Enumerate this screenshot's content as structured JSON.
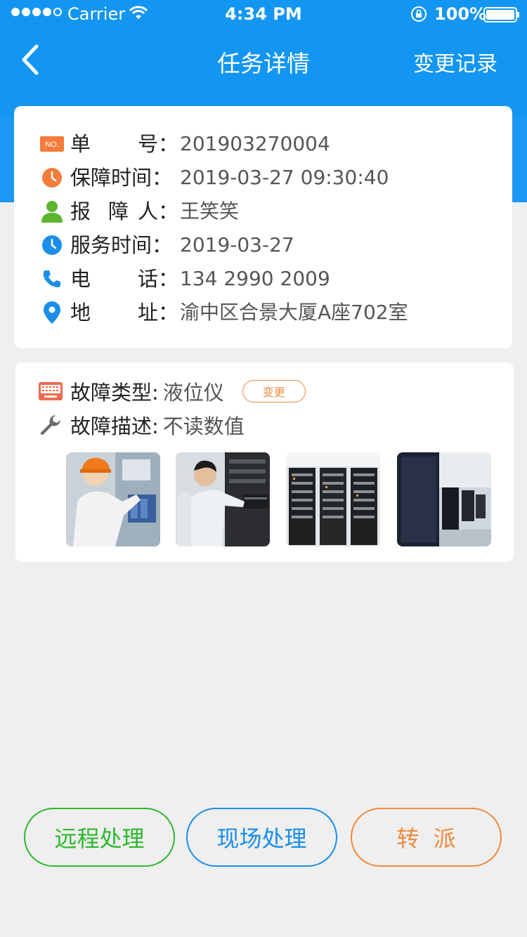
{
  "status_bar": {
    "carrier": "Carrier",
    "time": "4:34 PM",
    "battery": "100%"
  },
  "nav": {
    "title": "任务详情",
    "right_action": "变更记录"
  },
  "info": {
    "order_no": {
      "label": [
        "单",
        "号："
      ],
      "value": "201903270004",
      "icon": "no-badge-icon"
    },
    "report_time": {
      "label": "保障时间：",
      "value": "2019-03-27 09:30:40",
      "icon": "orange-clock-icon"
    },
    "reporter": {
      "label": [
        "报",
        "障",
        "人："
      ],
      "value": "王笑笑",
      "icon": "person-icon"
    },
    "service_time": {
      "label": "服务时间：",
      "value": "2019-03-27",
      "icon": "blue-clock-icon"
    },
    "phone": {
      "label": [
        "电",
        "话："
      ],
      "value": "134 2990 2009",
      "icon": "phone-icon"
    },
    "address": {
      "label": [
        "地",
        "址："
      ],
      "value": "渝中区合景大厦A座702室",
      "icon": "location-pin-icon"
    }
  },
  "fault": {
    "type_label": "故障类型:",
    "type_value": "液位仪",
    "change_label": "变更",
    "desc_label": "故障描述:",
    "desc_value": "不读数值"
  },
  "actions": {
    "remote": "远程处理",
    "onsite": "现场处理",
    "transfer": "转  派"
  },
  "colors": {
    "header": "#1296f2",
    "green": "#2eb82e",
    "blue": "#1a8ee8",
    "orange": "#f08a3c"
  }
}
